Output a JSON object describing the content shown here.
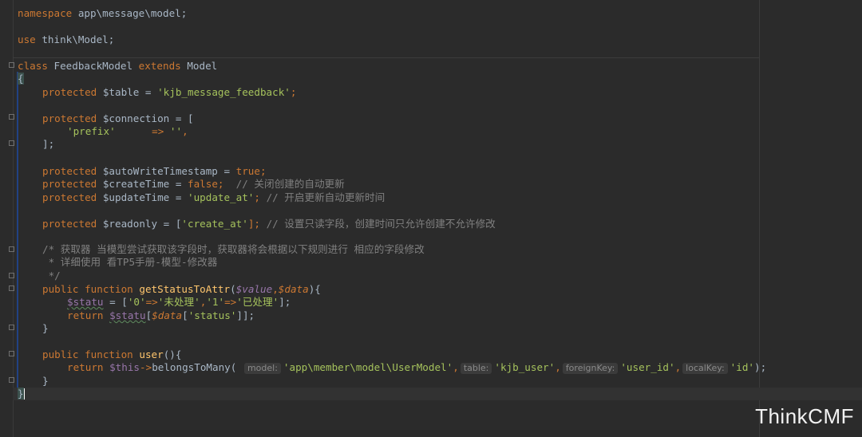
{
  "lines": {
    "l1": [
      "namespace",
      " app\\message\\model;"
    ],
    "l2": [
      "use",
      " think\\Model;"
    ],
    "l3": [
      "class",
      " FeedbackModel ",
      "extends",
      " Model"
    ],
    "l4": "{",
    "l5": [
      "protected",
      " $table = ",
      "'kjb_message_feedback'",
      ";"
    ],
    "l6": [
      "protected",
      " $connection = ["
    ],
    "l7": [
      "'prefix'",
      "      => ",
      "''",
      ","
    ],
    "l8": "];",
    "l9": [
      "protected",
      " $autoWriteTimestamp = ",
      "true",
      ";"
    ],
    "l10": [
      "protected",
      " $createTime = ",
      "false",
      ";  ",
      "// 关闭创建的自动更新"
    ],
    "l11": [
      "protected",
      " $updateTime = ",
      "'update_at'",
      "; ",
      "// 开启更新自动更新时间"
    ],
    "l12": [
      "protected",
      " $readonly = [",
      "'create_at'",
      "]; ",
      "// 设置只读字段，创建时间只允许创建不允许修改"
    ],
    "l13": "/* 获取器 当模型尝试获取该字段时，获取器将会根据以下规则进行 相应的字段修改",
    "l14": " * 详细使用 看TP5手册-模型-修改器",
    "l15": " */",
    "l16": [
      "public",
      " ",
      "function",
      " ",
      "getStatusToAttr",
      "(",
      "$value",
      ",",
      "$data",
      "){"
    ],
    "l17": [
      "$statu",
      " = [",
      "'0'",
      "=>",
      "'未处理'",
      ",",
      "'1'",
      "=>",
      "'已处理'",
      "];"
    ],
    "l18": [
      "return",
      " ",
      "$statu",
      "[",
      "$data",
      "[",
      "'status'",
      "]];"
    ],
    "l19": "}",
    "l20": [
      "public",
      " ",
      "function",
      " ",
      "user",
      "(){"
    ],
    "l21": [
      "return",
      " ",
      "$this",
      "->",
      "belongsToMany",
      "( ",
      "model:",
      "'app\\member\\model\\UserModel'",
      ",",
      "table:",
      "'kjb_user'",
      ",",
      "foreignKey:",
      "'user_id'",
      ",",
      "localKey:",
      "'id'",
      ");"
    ],
    "l22": "}",
    "l23": "}"
  },
  "watermark": "ThinkCMF",
  "colors": {
    "background": "#2b2b2b",
    "keyword": "#cc7832",
    "string": "#a5c25c",
    "comment": "#808080",
    "variable": "#9876aa",
    "function": "#ffc66d",
    "text": "#a9b7c6"
  }
}
